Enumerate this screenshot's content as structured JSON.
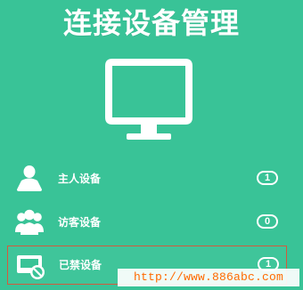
{
  "title": "连接设备管理",
  "hero": {
    "icon": "monitor-icon"
  },
  "devices": [
    {
      "icon": "single-user-icon",
      "label": "主人设备",
      "count": "1"
    },
    {
      "icon": "multi-user-icon",
      "label": "访客设备",
      "count": "0"
    },
    {
      "icon": "blocked-device-icon",
      "label": "已禁设备",
      "count": "1"
    }
  ],
  "watermark": "http://www.886abc.com",
  "colors": {
    "background": "#39c397",
    "foreground": "#ffffff",
    "highlight_border": "#d45a3d",
    "watermark_text": "#ff6a00"
  }
}
